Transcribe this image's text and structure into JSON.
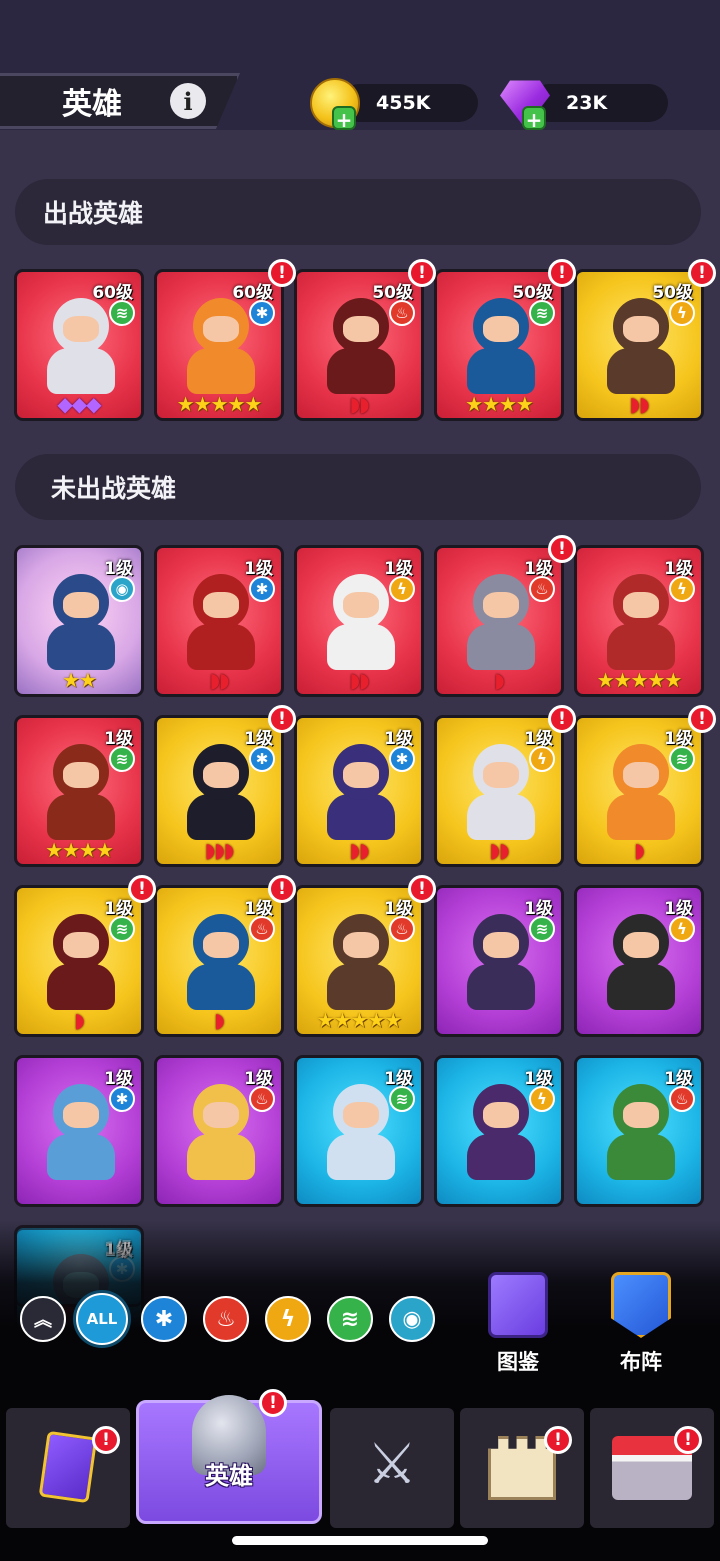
{
  "header": {
    "title": "英雄"
  },
  "currencies": {
    "coins": "455K",
    "gems": "23K"
  },
  "sections": {
    "active": "出战英雄",
    "inactive": "未出战英雄"
  },
  "active_heroes": [
    {
      "level": "60级",
      "element": "wind",
      "rank": "◆◆◆",
      "rank_type": "gems",
      "bg": "red",
      "alert": false
    },
    {
      "level": "60级",
      "element": "ice",
      "rank": "★★★★★",
      "rank_type": "stars",
      "bg": "red",
      "alert": true
    },
    {
      "level": "50级",
      "element": "fire",
      "rank": "◗◗",
      "rank_type": "moons",
      "bg": "red",
      "alert": true
    },
    {
      "level": "50级",
      "element": "wind",
      "rank": "★★★★",
      "rank_type": "stars",
      "bg": "red",
      "alert": true
    },
    {
      "level": "50级",
      "element": "bolt",
      "rank": "◗◗",
      "rank_type": "moons",
      "bg": "yellow",
      "alert": true
    }
  ],
  "inactive_heroes": [
    {
      "level": "1级",
      "element": "eye",
      "rank": "★★",
      "rank_type": "stars",
      "bg": "pink",
      "alert": false
    },
    {
      "level": "1级",
      "element": "ice",
      "rank": "◗◗",
      "rank_type": "moons",
      "bg": "red",
      "alert": false
    },
    {
      "level": "1级",
      "element": "bolt",
      "rank": "◗◗",
      "rank_type": "moons",
      "bg": "red",
      "alert": false
    },
    {
      "level": "1级",
      "element": "fire",
      "rank": "◗",
      "rank_type": "moons",
      "bg": "red",
      "alert": true
    },
    {
      "level": "1级",
      "element": "bolt",
      "rank": "★★★★★",
      "rank_type": "stars",
      "bg": "red",
      "alert": false
    },
    {
      "level": "1级",
      "element": "wind",
      "rank": "★★★★",
      "rank_type": "stars",
      "bg": "red",
      "alert": false
    },
    {
      "level": "1级",
      "element": "ice",
      "rank": "◗◗◗",
      "rank_type": "moons",
      "bg": "yellow",
      "alert": true
    },
    {
      "level": "1级",
      "element": "ice",
      "rank": "◗◗",
      "rank_type": "moons",
      "bg": "yellow",
      "alert": false
    },
    {
      "level": "1级",
      "element": "bolt",
      "rank": "◗◗",
      "rank_type": "moons",
      "bg": "yellow",
      "alert": true
    },
    {
      "level": "1级",
      "element": "wind",
      "rank": "◗",
      "rank_type": "moons",
      "bg": "yellow",
      "alert": true
    },
    {
      "level": "1级",
      "element": "wind",
      "rank": "◗",
      "rank_type": "moons",
      "bg": "yellow",
      "alert": true
    },
    {
      "level": "1级",
      "element": "fire",
      "rank": "◗",
      "rank_type": "moons",
      "bg": "yellow",
      "alert": true
    },
    {
      "level": "1级",
      "element": "fire",
      "rank": "★★★★★",
      "rank_type": "stars",
      "bg": "yellow",
      "alert": true
    },
    {
      "level": "1级",
      "element": "wind",
      "rank": "",
      "rank_type": "moons",
      "bg": "purple",
      "alert": false
    },
    {
      "level": "1级",
      "element": "bolt",
      "rank": "",
      "rank_type": "moons",
      "bg": "purple",
      "alert": false
    },
    {
      "level": "1级",
      "element": "ice",
      "rank": "",
      "rank_type": "moons",
      "bg": "purple",
      "alert": false
    },
    {
      "level": "1级",
      "element": "fire",
      "rank": "",
      "rank_type": "moons",
      "bg": "purple",
      "alert": false
    },
    {
      "level": "1级",
      "element": "wind",
      "rank": "",
      "rank_type": "moons",
      "bg": "blue",
      "alert": false
    },
    {
      "level": "1级",
      "element": "bolt",
      "rank": "",
      "rank_type": "moons",
      "bg": "blue",
      "alert": false
    },
    {
      "level": "1级",
      "element": "fire",
      "rank": "",
      "rank_type": "moons",
      "bg": "blue",
      "alert": false
    },
    {
      "level": "1级",
      "element": "ice",
      "rank": "",
      "rank_type": "moons",
      "bg": "blue",
      "alert": false
    }
  ],
  "filters": {
    "all": "ALL"
  },
  "side_buttons": {
    "codex": "图鉴",
    "formation": "布阵"
  },
  "nav": {
    "heroes": "英雄"
  },
  "colors": {
    "accent": "#8a5cf0",
    "alert": "#e8192c",
    "coin": "#f4c21b",
    "gem": "#9b2de0"
  }
}
